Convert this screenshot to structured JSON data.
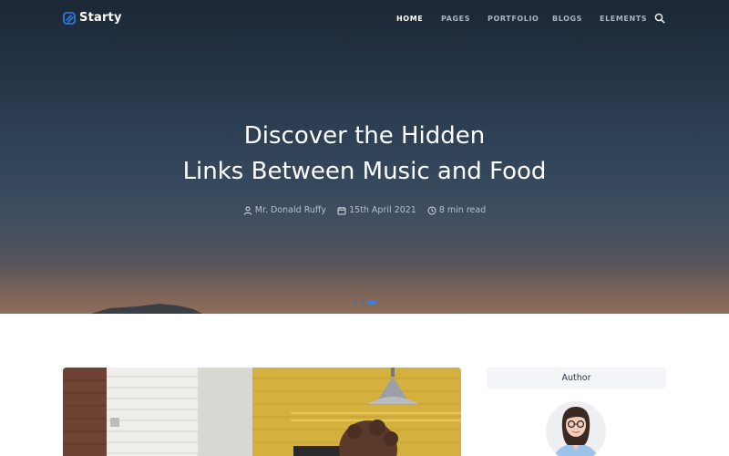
{
  "brand": {
    "name": "Starty",
    "accent": "#2f80ed"
  },
  "nav": {
    "items": [
      {
        "label": "HOME",
        "active": true
      },
      {
        "label": "PAGES",
        "active": false
      },
      {
        "label": "PORTFOLIO",
        "active": false
      },
      {
        "label": "BLOGS",
        "active": false
      },
      {
        "label": "ELEMENTS",
        "active": false
      }
    ],
    "search_icon": "search-icon"
  },
  "hero": {
    "title_line1": "Discover the Hidden",
    "title_line2": "Links Between Music and Food",
    "meta": {
      "author": "Mr. Donald Ruffy",
      "date": "15th April 2021",
      "read_time": "8 min read"
    },
    "slider": {
      "count": 3,
      "active_index": 2
    }
  },
  "sidebar": {
    "heading": "Author"
  }
}
